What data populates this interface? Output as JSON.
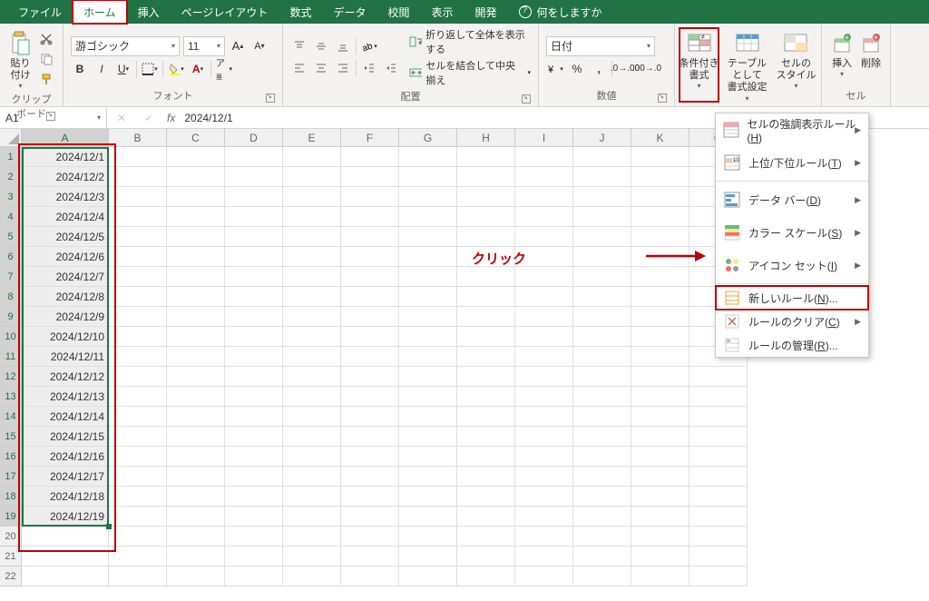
{
  "tabs": {
    "file": "ファイル",
    "home": "ホーム",
    "insert": "挿入",
    "page_layout": "ページレイアウト",
    "formulas": "数式",
    "data": "データ",
    "review": "校閲",
    "view": "表示",
    "developer": "開発",
    "tell_me": "何をしますか"
  },
  "ribbon": {
    "clipboard": {
      "paste": "貼り付け",
      "label": "クリップボード"
    },
    "font": {
      "name": "游ゴシック",
      "size": "11",
      "label": "フォント"
    },
    "alignment": {
      "wrap": "折り返して全体を表示する",
      "merge": "セルを結合して中央揃え",
      "label": "配置"
    },
    "number": {
      "format": "日付",
      "label": "数値"
    },
    "styles": {
      "cond_fmt": "条件付き\n書式",
      "table_fmt": "テーブルとして\n書式設定",
      "cell_styles": "セルの\nスタイル"
    },
    "cells": {
      "insert": "挿入",
      "delete": "削除",
      "label": "セル"
    }
  },
  "formula_bar": {
    "cell_ref": "A1",
    "formula": "2024/12/1"
  },
  "columns": [
    "A",
    "B",
    "C",
    "D",
    "E",
    "F",
    "G",
    "H",
    "I",
    "J",
    "K",
    "O"
  ],
  "data_rows": [
    "2024/12/1",
    "2024/12/2",
    "2024/12/3",
    "2024/12/4",
    "2024/12/5",
    "2024/12/6",
    "2024/12/7",
    "2024/12/8",
    "2024/12/9",
    "2024/12/10",
    "2024/12/11",
    "2024/12/12",
    "2024/12/13",
    "2024/12/14",
    "2024/12/15",
    "2024/12/16",
    "2024/12/17",
    "2024/12/18",
    "2024/12/19"
  ],
  "cf_menu": {
    "highlight_rules": "セルの強調表示ルール",
    "highlight_mnemonic": "H",
    "top_bottom": "上位/下位ルール",
    "top_bottom_mnemonic": "T",
    "data_bars": "データ バー",
    "data_bars_mnemonic": "D",
    "color_scales": "カラー スケール",
    "color_scales_mnemonic": "S",
    "icon_sets": "アイコン セット",
    "icon_sets_mnemonic": "I",
    "new_rule": "新しいルール",
    "new_rule_mnemonic": "N",
    "new_rule_suffix": "...",
    "clear_rules": "ルールのクリア",
    "clear_rules_mnemonic": "C",
    "manage_rules": "ルールの管理",
    "manage_rules_mnemonic": "R",
    "manage_rules_suffix": "..."
  },
  "annotation": {
    "click": "クリック"
  }
}
